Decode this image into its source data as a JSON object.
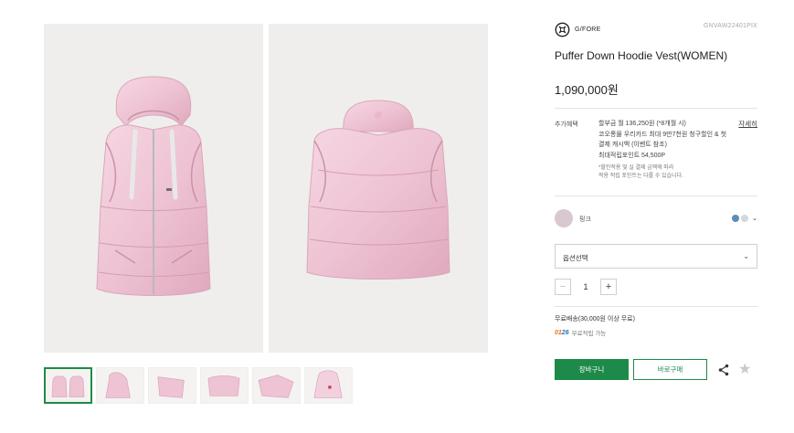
{
  "brand": {
    "name": "G/FORE",
    "logo_icon": "gfore-logo-icon"
  },
  "product": {
    "code": "GNVAW22401PIX",
    "title": "Puffer Down Hoodie Vest(WOMEN)",
    "price": "1,090,000원"
  },
  "gallery": {
    "main_images": [
      {
        "name": "front-view-image",
        "color": "#f1c9d8"
      },
      {
        "name": "back-view-image",
        "color": "#f1c9d8"
      }
    ],
    "thumbnail_count": 6,
    "active_thumbnail": 0
  },
  "benefits": {
    "label": "추가혜택",
    "detail_link": "자세히",
    "lines": [
      "할부금 월 136,250원 (*8개월 시)",
      "코오롱몰 우리카드 최대 9만7천원 청구할인 & 첫",
      "결제 캐시백 (이벤트 참조)",
      "최대적립포인트 54,500P"
    ],
    "notes": [
      "*할인적용 및 실 결제 금액에 따라",
      "적용 적립 포인트는 다를 수 있습니다."
    ]
  },
  "color_option": {
    "selected_name": "핑크",
    "selected_hex": "#d8c8cf",
    "other_swatches": [
      "#5b8fb9",
      "#d5d6da"
    ],
    "chevron_icon": "chevron-down-icon"
  },
  "option_select": {
    "placeholder": "옵션선택",
    "chevron_icon": "chevron-down-icon"
  },
  "quantity": {
    "value": "1",
    "minus_label": "−",
    "plus_label": "+"
  },
  "shipping": {
    "text": "무료배송(30,000원 이상 무료)"
  },
  "points": {
    "badge_prefix": "01",
    "badge_suffix": "26",
    "text": "무료적립 가능"
  },
  "actions": {
    "cart_label": "장바구니",
    "buy_label": "바로구매",
    "share_icon": "share-icon",
    "wishlist_icon": "star-icon",
    "accent": "#1e8a4a"
  }
}
